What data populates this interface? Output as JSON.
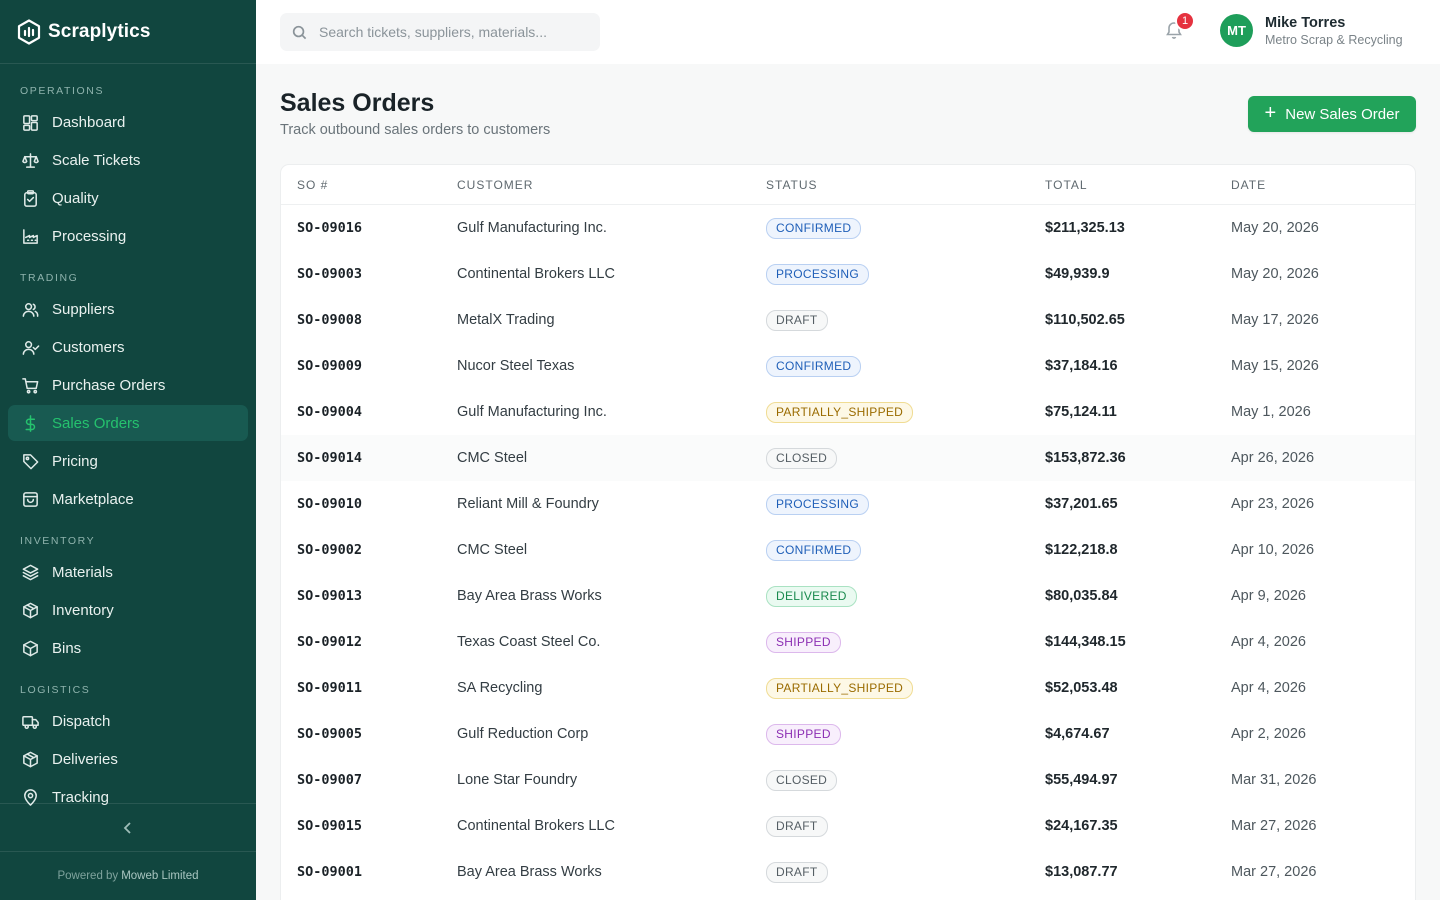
{
  "brand": {
    "name": "Scraplytics"
  },
  "sidebar": {
    "sections": [
      {
        "label": "OPERATIONS",
        "items": [
          {
            "label": "Dashboard",
            "icon": "dashboard-icon"
          },
          {
            "label": "Scale Tickets",
            "icon": "scale-icon"
          },
          {
            "label": "Quality",
            "icon": "clipboard-check-icon"
          },
          {
            "label": "Processing",
            "icon": "factory-icon"
          }
        ]
      },
      {
        "label": "TRADING",
        "items": [
          {
            "label": "Suppliers",
            "icon": "users-icon"
          },
          {
            "label": "Customers",
            "icon": "user-check-icon"
          },
          {
            "label": "Purchase Orders",
            "icon": "cart-icon"
          },
          {
            "label": "Sales Orders",
            "icon": "dollar-icon",
            "active": true
          },
          {
            "label": "Pricing",
            "icon": "tag-icon"
          },
          {
            "label": "Marketplace",
            "icon": "shopping-bag-icon"
          }
        ]
      },
      {
        "label": "INVENTORY",
        "items": [
          {
            "label": "Materials",
            "icon": "layers-icon"
          },
          {
            "label": "Inventory",
            "icon": "package-icon"
          },
          {
            "label": "Bins",
            "icon": "box-icon"
          }
        ]
      },
      {
        "label": "LOGISTICS",
        "items": [
          {
            "label": "Dispatch",
            "icon": "truck-icon"
          },
          {
            "label": "Deliveries",
            "icon": "package-check-icon"
          },
          {
            "label": "Tracking",
            "icon": "map-pin-icon"
          }
        ]
      }
    ],
    "powered_prefix": "Powered by",
    "powered_company": "Moweb Limited"
  },
  "topbar": {
    "search_placeholder": "Search tickets, suppliers, materials...",
    "notification_count": "1",
    "user_initials": "MT",
    "user_name": "Mike Torres",
    "user_org": "Metro Scrap & Recycling"
  },
  "header": {
    "title": "Sales Orders",
    "subtitle": "Track outbound sales orders to customers",
    "new_button": "New Sales Order",
    "accent": "#22a35a"
  },
  "table": {
    "columns": [
      "SO #",
      "CUSTOMER",
      "STATUS",
      "TOTAL",
      "DATE"
    ],
    "rows": [
      {
        "so": "SO-09016",
        "customer": "Gulf Manufacturing Inc.",
        "status": "CONFIRMED",
        "total": "$211,325.13",
        "date": "May 20, 2026"
      },
      {
        "so": "SO-09003",
        "customer": "Continental Brokers LLC",
        "status": "PROCESSING",
        "total": "$49,939.9",
        "date": "May 20, 2026"
      },
      {
        "so": "SO-09008",
        "customer": "MetalX Trading",
        "status": "DRAFT",
        "total": "$110,502.65",
        "date": "May 17, 2026"
      },
      {
        "so": "SO-09009",
        "customer": "Nucor Steel Texas",
        "status": "CONFIRMED",
        "total": "$37,184.16",
        "date": "May 15, 2026"
      },
      {
        "so": "SO-09004",
        "customer": "Gulf Manufacturing Inc.",
        "status": "PARTIALLY_SHIPPED",
        "total": "$75,124.11",
        "date": "May 1, 2026"
      },
      {
        "so": "SO-09014",
        "customer": "CMC Steel",
        "status": "CLOSED",
        "total": "$153,872.36",
        "date": "Apr 26, 2026"
      },
      {
        "so": "SO-09010",
        "customer": "Reliant Mill & Foundry",
        "status": "PROCESSING",
        "total": "$37,201.65",
        "date": "Apr 23, 2026"
      },
      {
        "so": "SO-09002",
        "customer": "CMC Steel",
        "status": "CONFIRMED",
        "total": "$122,218.8",
        "date": "Apr 10, 2026"
      },
      {
        "so": "SO-09013",
        "customer": "Bay Area Brass Works",
        "status": "DELIVERED",
        "total": "$80,035.84",
        "date": "Apr 9, 2026"
      },
      {
        "so": "SO-09012",
        "customer": "Texas Coast Steel Co.",
        "status": "SHIPPED",
        "total": "$144,348.15",
        "date": "Apr 4, 2026"
      },
      {
        "so": "SO-09011",
        "customer": "SA Recycling",
        "status": "PARTIALLY_SHIPPED",
        "total": "$52,053.48",
        "date": "Apr 4, 2026"
      },
      {
        "so": "SO-09005",
        "customer": "Gulf Reduction Corp",
        "status": "SHIPPED",
        "total": "$4,674.67",
        "date": "Apr 2, 2026"
      },
      {
        "so": "SO-09007",
        "customer": "Lone Star Foundry",
        "status": "CLOSED",
        "total": "$55,494.97",
        "date": "Mar 31, 2026"
      },
      {
        "so": "SO-09015",
        "customer": "Continental Brokers LLC",
        "status": "DRAFT",
        "total": "$24,167.35",
        "date": "Mar 27, 2026"
      },
      {
        "so": "SO-09001",
        "customer": "Bay Area Brass Works",
        "status": "DRAFT",
        "total": "$13,087.77",
        "date": "Mar 27, 2026"
      }
    ]
  }
}
